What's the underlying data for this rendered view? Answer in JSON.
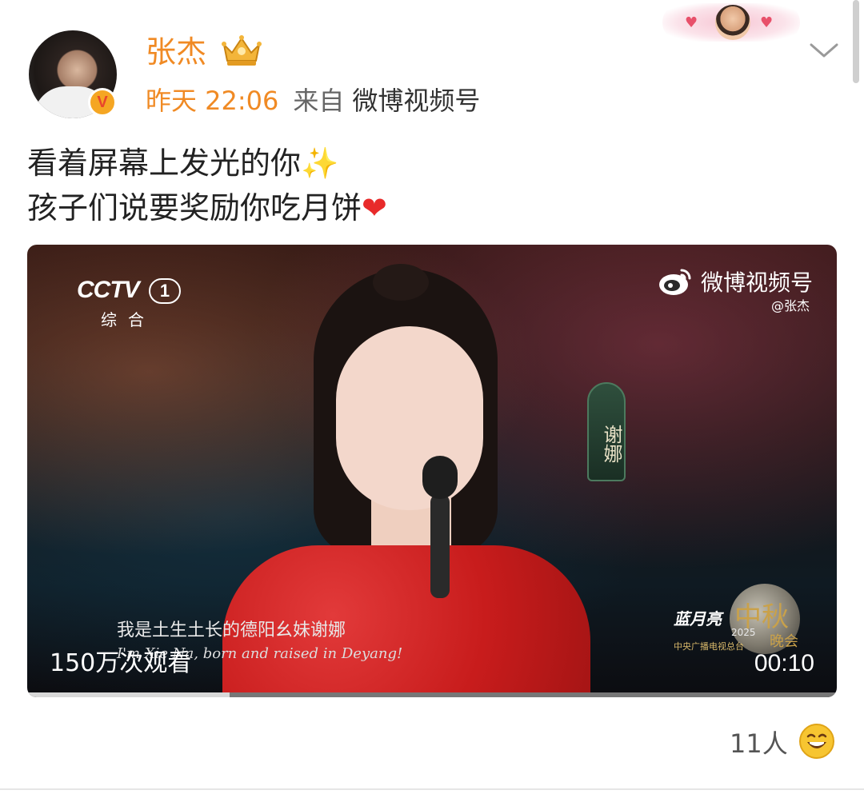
{
  "post": {
    "username": "张杰",
    "time": "昨天 22:06",
    "source_prefix": "来自",
    "source_name": "微博视频号",
    "text_line1": "看着屏幕上发光的你",
    "text_line2": "孩子们说要奖励你吃月饼",
    "sparkle_glyph": "✨",
    "heart_glyph": "❤"
  },
  "video": {
    "channel_logo": "CCTV",
    "channel_number": "1",
    "channel_sub": "综合",
    "watermark_brand": "微博视频号",
    "watermark_handle": "@张杰",
    "name_tag": "谢娜",
    "subtitle_cn": "我是土生土长的德阳幺妹谢娜",
    "subtitle_en": "I'm Xie Na, born and raised in Deyang!",
    "show_logo_brand": "蓝月亮",
    "show_logo_main": "中秋",
    "show_logo_year": "2025",
    "show_logo_tail": "晚会",
    "show_logo_org": "中央广播电视总台",
    "views": "150万次观看",
    "duration": "00:10",
    "progress_fraction": 0.25
  },
  "reactions": {
    "count": "11人"
  },
  "colors": {
    "username": "#f08a24",
    "time": "#f08a24",
    "verified_badge": "#f5a623",
    "heart": "#e82a2a",
    "sparkle": "#f4c430"
  }
}
